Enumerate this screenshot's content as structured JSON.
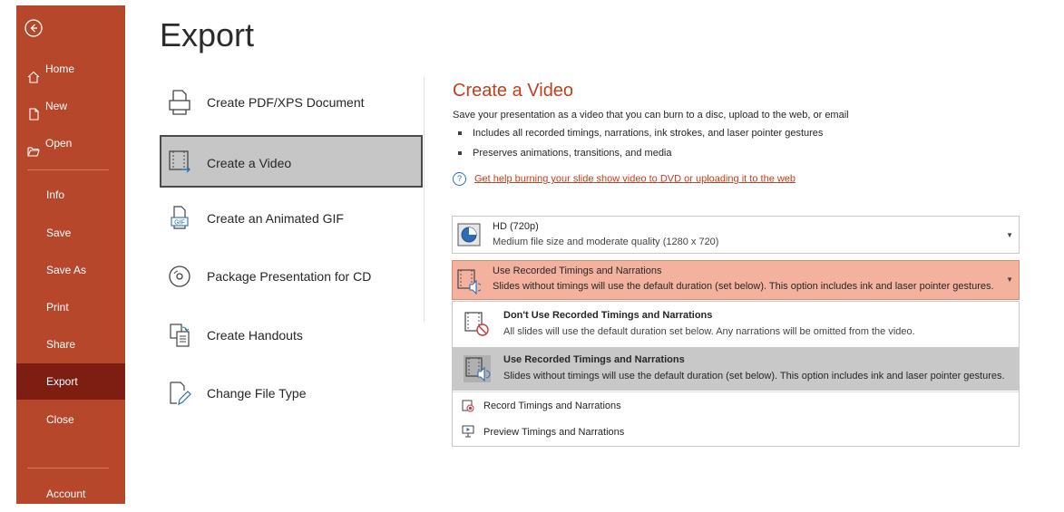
{
  "colors": {
    "brand": "#b7472a",
    "active": "#7e1d12",
    "accent_text": "#c43e1c",
    "highlight": "#f4b29e",
    "link": "#2e6db4"
  },
  "sidebar": {
    "back_icon": "circle-arrow-left-icon",
    "top_items": [
      {
        "label": "Home",
        "icon": "home-icon"
      },
      {
        "label": "New",
        "icon": "new-document-icon"
      },
      {
        "label": "Open",
        "icon": "folder-open-icon"
      }
    ],
    "items": [
      {
        "label": "Info"
      },
      {
        "label": "Save"
      },
      {
        "label": "Save As"
      },
      {
        "label": "Print"
      },
      {
        "label": "Share"
      },
      {
        "label": "Export"
      },
      {
        "label": "Close"
      }
    ],
    "account": "Account"
  },
  "page": {
    "title": "Export"
  },
  "export_options": [
    {
      "label": "Create PDF/XPS Document",
      "icon": "pdf-document-icon"
    },
    {
      "label": "Create a Video",
      "icon": "video-icon"
    },
    {
      "label": "Create an Animated GIF",
      "icon": "gif-icon"
    },
    {
      "label": "Package Presentation for CD",
      "icon": "cd-icon"
    },
    {
      "label": "Create Handouts",
      "icon": "handouts-icon"
    },
    {
      "label": "Change File Type",
      "icon": "change-file-type-icon"
    }
  ],
  "video_pane": {
    "title": "Create a Video",
    "description": "Save your presentation as a video that you can burn to a disc, upload to the web, or email",
    "bullets": [
      "Includes all recorded timings, narrations, ink strokes, and laser pointer gestures",
      "Preserves animations, transitions, and media"
    ],
    "help_link": "Get help burning your slide show video to DVD or uploading it to the web",
    "quality": {
      "title": "HD (720p)",
      "subtitle": "Medium file size and moderate quality (1280 x 720)",
      "icon": "quality-icon"
    },
    "timing": {
      "title": "Use Recorded Timings and Narrations",
      "subtitle": "Slides without timings will use the default duration (set below). This option includes ink and laser pointer gestures.",
      "icon": "timings-narration-icon"
    },
    "menu": {
      "options": [
        {
          "title": "Don't Use Recorded Timings and Narrations",
          "subtitle": "All slides will use the default duration set below. Any narrations will be omitted from the video.",
          "icon": "no-timings-icon"
        },
        {
          "title": "Use Recorded Timings and Narrations",
          "subtitle": "Slides without timings will use the default duration (set below). This option includes ink and laser pointer gestures.",
          "icon": "timings-narration-icon"
        }
      ],
      "actions": [
        {
          "label": "Record Timings and Narrations",
          "icon": "record-icon"
        },
        {
          "label": "Preview Timings and Narrations",
          "icon": "preview-icon"
        }
      ]
    }
  }
}
